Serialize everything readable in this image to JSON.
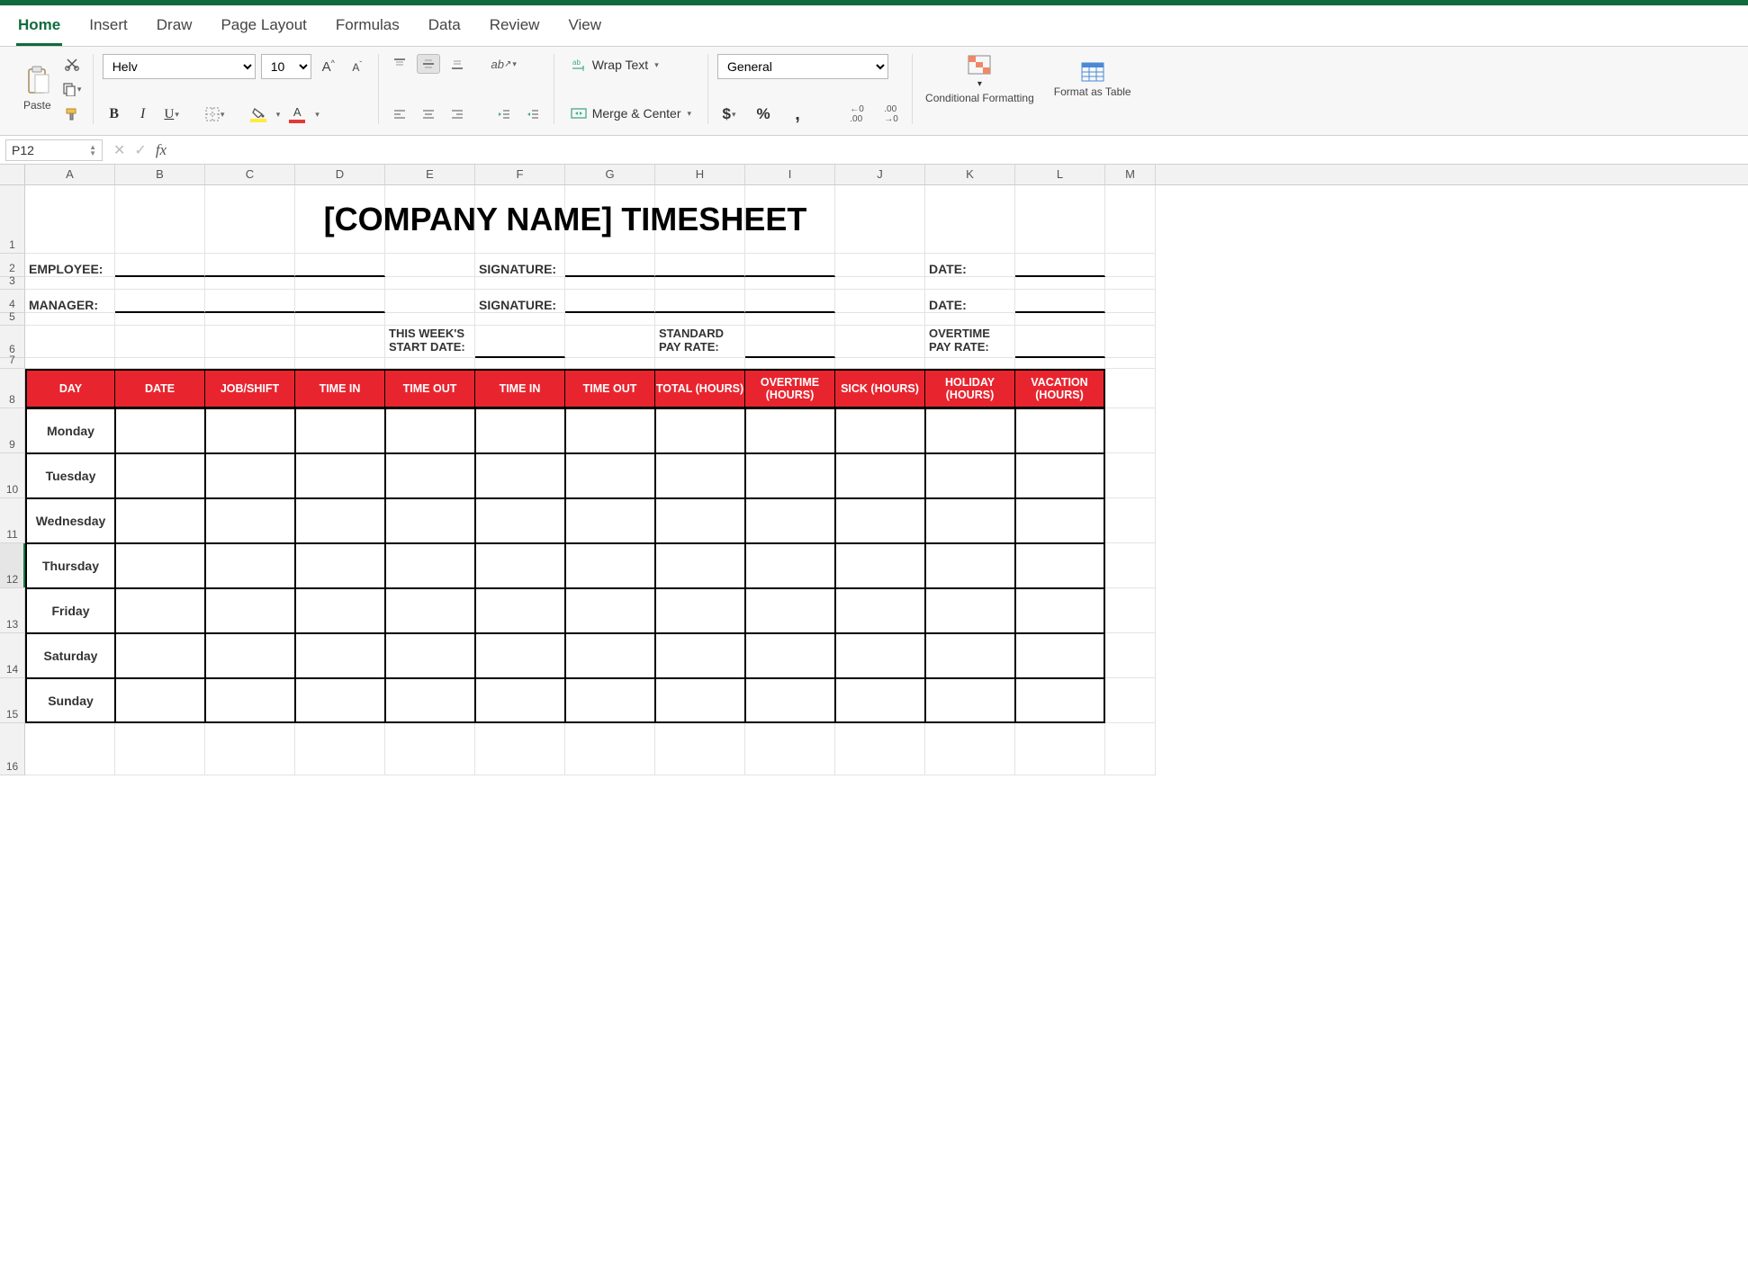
{
  "tabs": [
    "Home",
    "Insert",
    "Draw",
    "Page Layout",
    "Formulas",
    "Data",
    "Review",
    "View"
  ],
  "active_tab": "Home",
  "ribbon": {
    "paste": "Paste",
    "font_name": "Helv",
    "font_size": "10",
    "wrap": "Wrap Text",
    "merge": "Merge & Center",
    "numfmt": "General",
    "cond_fmt": "Conditional Formatting",
    "fmt_table": "Format as Table"
  },
  "namebox": "P12",
  "formula_value": "",
  "columns": [
    "A",
    "B",
    "C",
    "D",
    "E",
    "F",
    "G",
    "H",
    "I",
    "J",
    "K",
    "L",
    "M"
  ],
  "sheet": {
    "title": "[COMPANY NAME] TIMESHEET",
    "employee": "EMPLOYEE:",
    "manager": "MANAGER:",
    "signature": "SIGNATURE:",
    "date": "DATE:",
    "week_start": "THIS WEEK'S START DATE:",
    "std_rate": "STANDARD PAY RATE:",
    "ot_rate": "OVERTIME PAY RATE:",
    "headers": [
      "DAY",
      "DATE",
      "JOB/SHIFT",
      "TIME IN",
      "TIME OUT",
      "TIME IN",
      "TIME OUT",
      "TOTAL (HOURS)",
      "OVERTIME (HOURS)",
      "SICK (HOURS)",
      "HOLIDAY (HOURS)",
      "VACATION (HOURS)"
    ],
    "days": [
      "Monday",
      "Tuesday",
      "Wednesday",
      "Thursday",
      "Friday",
      "Saturday",
      "Sunday"
    ]
  }
}
